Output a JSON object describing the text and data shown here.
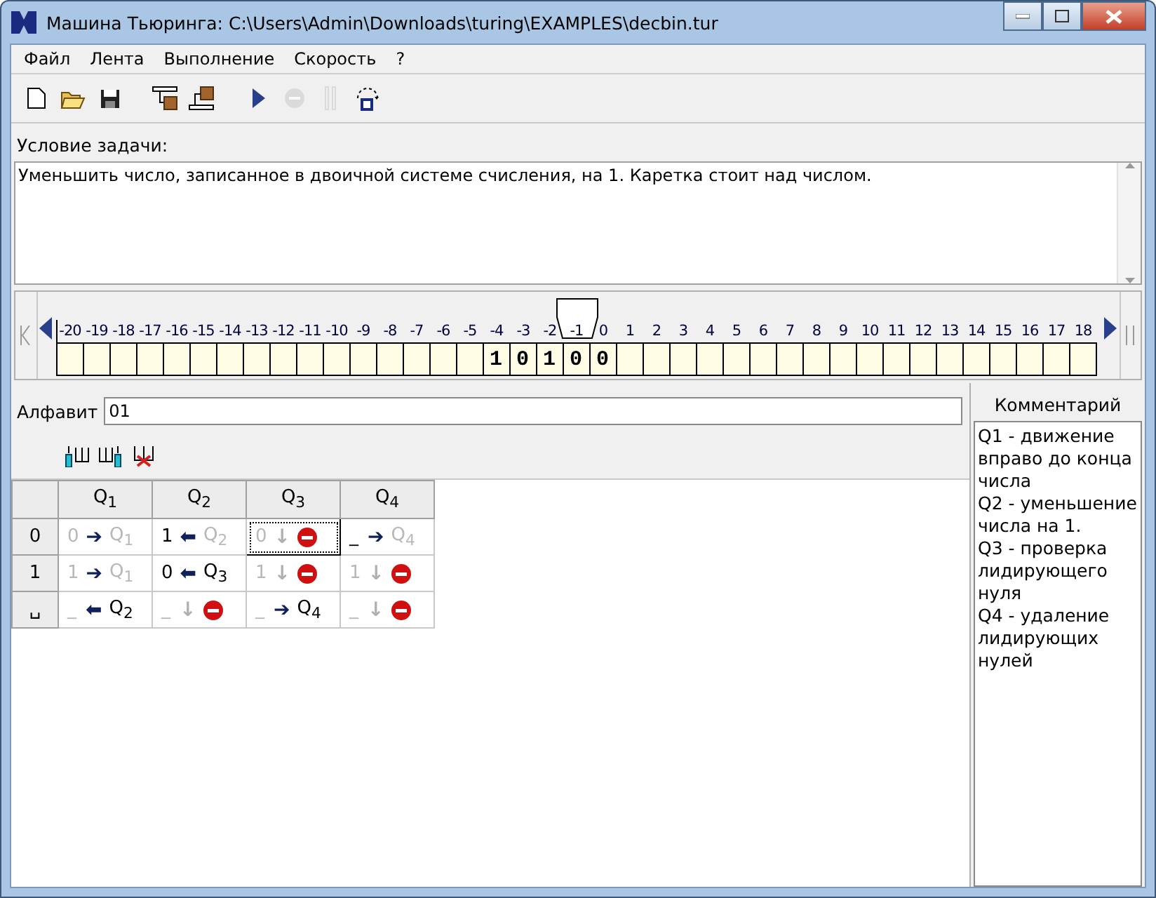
{
  "window": {
    "title": "Машина Тьюринга: C:\\Users\\Admin\\Downloads\\turing\\EXAMPLES\\decbin.tur"
  },
  "menu": [
    "Файл",
    "Лента",
    "Выполнение",
    "Скорость",
    "?"
  ],
  "toolbar": [
    {
      "kind": "new",
      "disabled": false
    },
    {
      "kind": "open",
      "disabled": false
    },
    {
      "kind": "save",
      "disabled": false
    },
    {
      "kind": "sep"
    },
    {
      "kind": "tape-load",
      "disabled": false
    },
    {
      "kind": "tape-save",
      "disabled": false
    },
    {
      "kind": "sep"
    },
    {
      "kind": "run",
      "disabled": false
    },
    {
      "kind": "stop",
      "disabled": true
    },
    {
      "kind": "pause",
      "disabled": true
    },
    {
      "kind": "step",
      "disabled": false
    }
  ],
  "task": {
    "label": "Условие задачи:",
    "text": "Уменьшить число, записанное в двоичной системе счисления, на 1. Каретка стоит над числом."
  },
  "tape": {
    "cells": [
      {
        "index": "-20",
        "selected": false
      },
      {
        "index": "-19",
        "selected": false
      },
      {
        "index": "-18",
        "selected": false
      },
      {
        "index": "-17",
        "selected": false
      },
      {
        "index": "-16",
        "selected": false
      },
      {
        "index": "-15",
        "selected": false
      },
      {
        "index": "-14",
        "selected": false
      },
      {
        "index": "-13",
        "selected": false
      },
      {
        "index": "-12",
        "selected": false
      },
      {
        "index": "-11",
        "selected": false
      },
      {
        "index": "-10",
        "selected": false
      },
      {
        "index": "-9",
        "selected": false
      },
      {
        "index": "-8",
        "selected": false
      },
      {
        "index": "-7",
        "selected": false
      },
      {
        "index": "-6",
        "selected": false
      },
      {
        "index": "-5",
        "selected": false
      },
      {
        "index": "-4",
        "symbol": "1",
        "selected": false
      },
      {
        "index": "-3",
        "symbol": "0",
        "selected": false
      },
      {
        "index": "-2",
        "symbol": "1",
        "selected": false
      },
      {
        "index": "-1",
        "symbol": "0",
        "selected": true
      },
      {
        "index": "0",
        "symbol": "0",
        "selected": false
      },
      {
        "index": "1",
        "selected": false
      },
      {
        "index": "2",
        "selected": false
      },
      {
        "index": "3",
        "selected": false
      },
      {
        "index": "4",
        "selected": false
      },
      {
        "index": "5",
        "selected": false
      },
      {
        "index": "6",
        "selected": false
      },
      {
        "index": "7",
        "selected": false
      },
      {
        "index": "8",
        "selected": false
      },
      {
        "index": "9",
        "selected": false
      },
      {
        "index": "10",
        "selected": false
      },
      {
        "index": "11",
        "selected": false
      },
      {
        "index": "12",
        "selected": false
      },
      {
        "index": "13",
        "selected": false
      },
      {
        "index": "14",
        "selected": false
      },
      {
        "index": "15",
        "selected": false
      },
      {
        "index": "16",
        "selected": false
      },
      {
        "index": "17",
        "selected": false
      },
      {
        "index": "18",
        "selected": false
      }
    ]
  },
  "alphabet": {
    "label": "Алфавит",
    "value": "01"
  },
  "table": {
    "columns": [
      "Q$_{1}$",
      "Q$_{2}$",
      "Q$_{3}$",
      "Q$_{4}$"
    ],
    "rows": [
      {
        "symbol": "0",
        "cells": [
          {
            "write": "0",
            "write_dim": true,
            "move": "➔",
            "kind": "goto",
            "state": "Q$_{1}$",
            "state_dim": true,
            "focused": false
          },
          {
            "write": "1",
            "write_dim": false,
            "move": "⬅",
            "kind": "goto",
            "state": "Q$_{2}$",
            "state_dim": true,
            "focused": false
          },
          {
            "write": "0",
            "write_dim": true,
            "move": "↓",
            "kind": "stop",
            "focused": true
          },
          {
            "write": "_",
            "write_dim": false,
            "move": "➔",
            "kind": "goto",
            "state": "Q$_{4}$",
            "state_dim": true,
            "focused": false
          }
        ]
      },
      {
        "symbol": "1",
        "cells": [
          {
            "write": "1",
            "write_dim": true,
            "move": "➔",
            "kind": "goto",
            "state": "Q$_{1}$",
            "state_dim": true,
            "focused": false
          },
          {
            "write": "0",
            "write_dim": false,
            "move": "⬅",
            "kind": "goto",
            "state": "Q$_{3}$",
            "state_dim": false,
            "focused": false
          },
          {
            "write": "1",
            "write_dim": true,
            "move": "↓",
            "kind": "stop",
            "focused": false
          },
          {
            "write": "1",
            "write_dim": true,
            "move": "↓",
            "kind": "stop",
            "focused": false
          }
        ]
      },
      {
        "symbol": "␣",
        "cells": [
          {
            "write": "_",
            "write_dim": true,
            "move": "⬅",
            "kind": "goto",
            "state": "Q$_{2}$",
            "state_dim": false,
            "focused": false
          },
          {
            "write": "_",
            "write_dim": true,
            "move": "↓",
            "kind": "stop",
            "focused": false
          },
          {
            "write": "_",
            "write_dim": true,
            "move": "➔",
            "kind": "goto",
            "state": "Q$_{4}$",
            "state_dim": false,
            "focused": false
          },
          {
            "write": "_",
            "write_dim": true,
            "move": "↓",
            "kind": "stop",
            "focused": false
          }
        ]
      }
    ]
  },
  "comment": {
    "title": "Комментарий",
    "lines": [
      "Q1 - движение вправо до конца числа",
      "Q2 - уменьшение числа на 1.",
      "Q3 - проверка лидирующего нуля",
      "Q4 - удаление лидирующих нулей"
    ]
  }
}
